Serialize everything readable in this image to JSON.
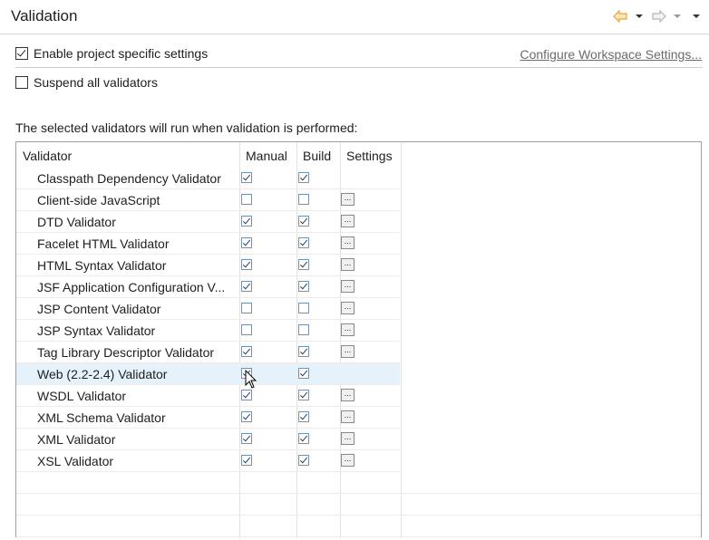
{
  "header": {
    "title": "Validation"
  },
  "options": {
    "enable_project_specific": {
      "label": "Enable project specific settings",
      "checked": true
    },
    "configure_link": "Configure Workspace Settings...",
    "suspend_all": {
      "label": "Suspend all validators",
      "checked": false
    },
    "description": "The selected validators will run when validation is performed:"
  },
  "table": {
    "columns": [
      "Validator",
      "Manual",
      "Build",
      "Settings"
    ],
    "rows": [
      {
        "name": "Classpath Dependency Validator",
        "manual": true,
        "build": true,
        "settings": false
      },
      {
        "name": "Client-side JavaScript",
        "manual": false,
        "build": false,
        "settings": true
      },
      {
        "name": "DTD Validator",
        "manual": true,
        "build": true,
        "settings": true
      },
      {
        "name": "Facelet HTML Validator",
        "manual": true,
        "build": true,
        "settings": true
      },
      {
        "name": "HTML Syntax Validator",
        "manual": true,
        "build": true,
        "settings": true
      },
      {
        "name": "JSF Application Configuration V...",
        "manual": true,
        "build": true,
        "settings": true
      },
      {
        "name": "JSP Content Validator",
        "manual": false,
        "build": false,
        "settings": true
      },
      {
        "name": "JSP Syntax Validator",
        "manual": false,
        "build": false,
        "settings": true
      },
      {
        "name": "Tag Library Descriptor Validator",
        "manual": true,
        "build": true,
        "settings": true
      },
      {
        "name": "Web (2.2-2.4) Validator",
        "manual": true,
        "build": true,
        "settings": false,
        "selected": true
      },
      {
        "name": "WSDL Validator",
        "manual": true,
        "build": true,
        "settings": true
      },
      {
        "name": "XML Schema Validator",
        "manual": true,
        "build": true,
        "settings": true
      },
      {
        "name": "XML Validator",
        "manual": true,
        "build": true,
        "settings": true
      },
      {
        "name": "XSL Validator",
        "manual": true,
        "build": true,
        "settings": true
      }
    ],
    "settings_button_label": "..."
  },
  "colors": {
    "selection": "#e5f1fb",
    "nav_arrow": "#e8a33d"
  }
}
